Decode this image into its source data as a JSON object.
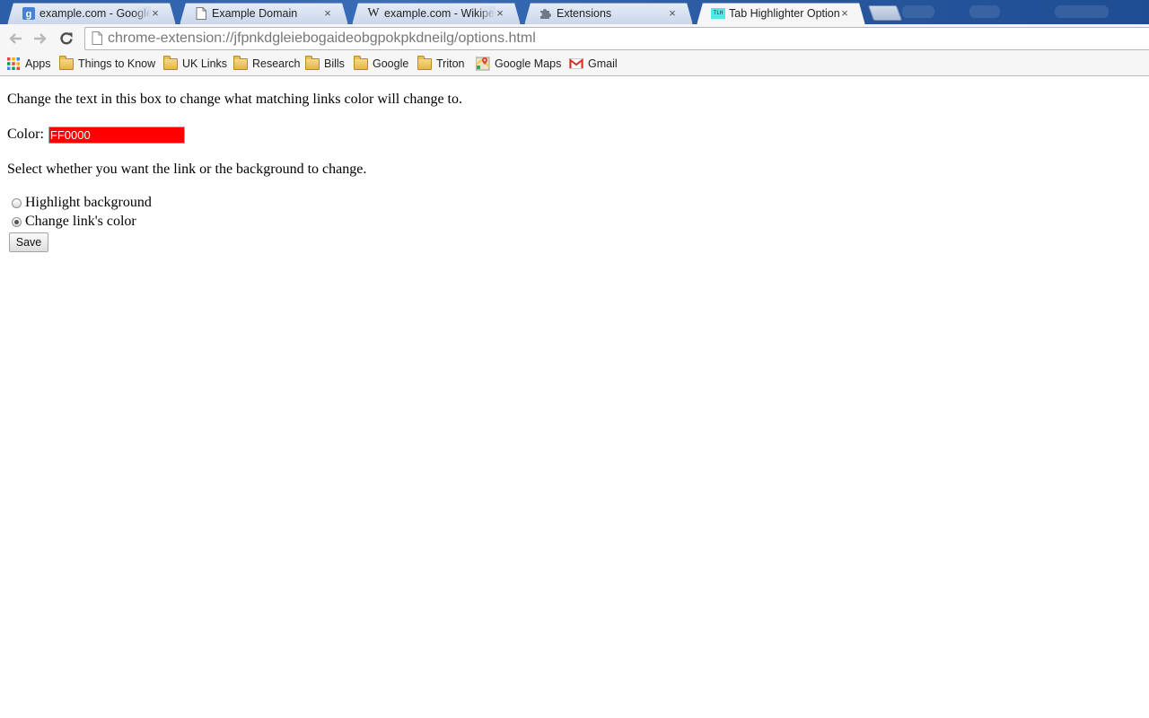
{
  "browser": {
    "tabs": [
      {
        "title": "example.com - Google Se",
        "icon": "google-icon",
        "active": false
      },
      {
        "title": "Example Domain",
        "icon": "page-icon",
        "active": false
      },
      {
        "title": "example.com - Wikipedia,",
        "icon": "wikipedia-icon",
        "active": false
      },
      {
        "title": "Extensions",
        "icon": "puzzle-icon",
        "active": false
      },
      {
        "title": "Tab Highlighter Options",
        "icon": "tlh-icon",
        "active": true
      }
    ],
    "tab_close_glyph": "×",
    "wikipedia_glyph": "W",
    "tlh_badge": "TLH",
    "url": "chrome-extension://jfpnkdgleiebogaideobgpokpkdneilg/options.html",
    "bookmarks": [
      {
        "label": "Apps",
        "icon": "apps-grid-icon"
      },
      {
        "label": "Things to Know",
        "icon": "folder-icon"
      },
      {
        "label": "UK Links",
        "icon": "folder-icon"
      },
      {
        "label": "Research",
        "icon": "folder-icon"
      },
      {
        "label": "Bills",
        "icon": "folder-icon"
      },
      {
        "label": "Google",
        "icon": "folder-icon"
      },
      {
        "label": "Triton",
        "icon": "folder-icon"
      },
      {
        "label": "Google Maps",
        "icon": "google-maps-icon"
      },
      {
        "label": "Gmail",
        "icon": "gmail-icon"
      }
    ]
  },
  "options": {
    "color_instruction": "Change the text in this box to change what matching links color will change to.",
    "color_label": "Color:",
    "color_value": "FF0000",
    "color_swatch": "#ff0000",
    "mode_instruction": "Select whether you want the link or the background to change.",
    "radio_options": [
      {
        "label": "Highlight background",
        "checked": false
      },
      {
        "label": "Change link's color",
        "checked": true
      }
    ],
    "save_label": "Save"
  }
}
